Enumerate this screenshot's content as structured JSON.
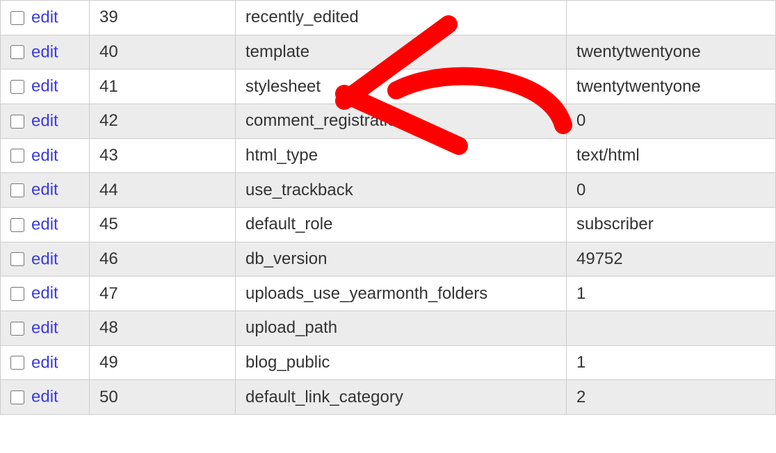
{
  "edit_label": "edit",
  "rows": [
    {
      "id": "39",
      "option_name": "recently_edited",
      "option_value": ""
    },
    {
      "id": "40",
      "option_name": "template",
      "option_value": "twentytwentyone"
    },
    {
      "id": "41",
      "option_name": "stylesheet",
      "option_value": "twentytwentyone"
    },
    {
      "id": "42",
      "option_name": "comment_registration",
      "option_value": "0"
    },
    {
      "id": "43",
      "option_name": "html_type",
      "option_value": "text/html"
    },
    {
      "id": "44",
      "option_name": "use_trackback",
      "option_value": "0"
    },
    {
      "id": "45",
      "option_name": "default_role",
      "option_value": "subscriber"
    },
    {
      "id": "46",
      "option_name": "db_version",
      "option_value": "49752"
    },
    {
      "id": "47",
      "option_name": "uploads_use_yearmonth_folders",
      "option_value": "1"
    },
    {
      "id": "48",
      "option_name": "upload_path",
      "option_value": ""
    },
    {
      "id": "49",
      "option_name": "blog_public",
      "option_value": "1"
    },
    {
      "id": "50",
      "option_name": "default_link_category",
      "option_value": "2"
    }
  ]
}
